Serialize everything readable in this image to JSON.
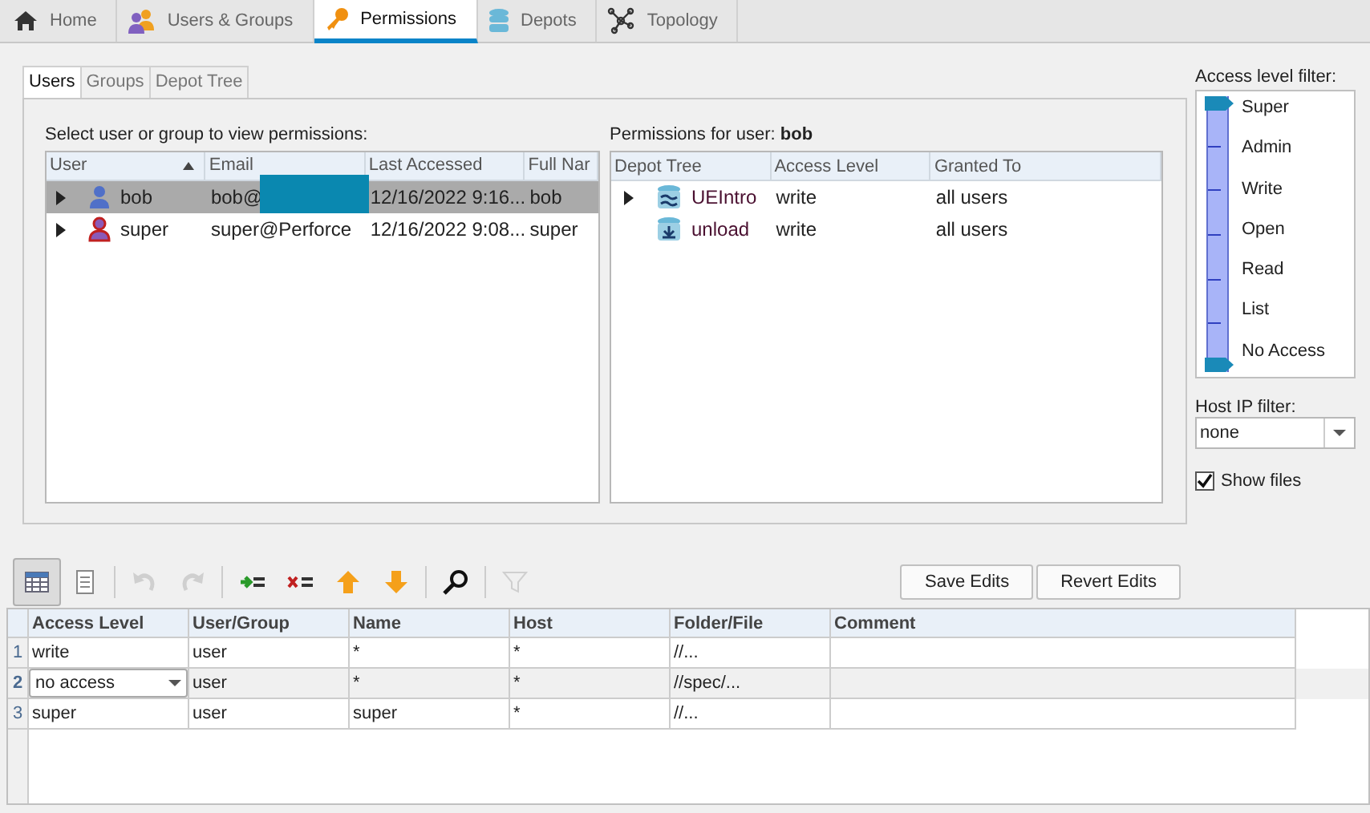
{
  "main_tabs": [
    {
      "label": "Home",
      "selected": false
    },
    {
      "label": "Users & Groups",
      "selected": false
    },
    {
      "label": "Permissions",
      "selected": true
    },
    {
      "label": "Depots",
      "selected": false
    },
    {
      "label": "Topology",
      "selected": false
    }
  ],
  "sub_tabs": [
    {
      "label": "Users",
      "selected": true
    },
    {
      "label": "Groups",
      "selected": false
    },
    {
      "label": "Depot Tree",
      "selected": false
    }
  ],
  "users_panel": {
    "prompt": "Select user or group to view permissions:",
    "columns": [
      {
        "label": "User",
        "sorted": true
      },
      {
        "label": "Email",
        "sorted": false
      },
      {
        "label": "Last Accessed",
        "sorted": false
      },
      {
        "label": "Full Nar",
        "sorted": false
      }
    ],
    "rows": [
      {
        "kind": "user",
        "user": "bob",
        "email": "bob@",
        "redacted": true,
        "last_accessed": "12/16/2022 9:16...",
        "full_name": "bob",
        "selected": true
      },
      {
        "kind": "super",
        "user": "super",
        "email": "super@Perforce",
        "redacted": false,
        "last_accessed": "12/16/2022 9:08...",
        "full_name": "super",
        "selected": false
      }
    ]
  },
  "permissions_panel": {
    "prompt": "Permissions for user: ",
    "user": "bob",
    "columns": [
      "Depot Tree",
      "Access Level",
      "Granted To"
    ],
    "rows": [
      {
        "kind": "stream",
        "expandable": true,
        "depot": "UEIntro",
        "access": "write",
        "granted_to": "all users"
      },
      {
        "kind": "unload",
        "expandable": false,
        "depot": "unload",
        "access": "write",
        "granted_to": "all users"
      }
    ]
  },
  "access_filter": {
    "title": "Access level filter:",
    "levels": [
      "Super",
      "Admin",
      "Write",
      "Open",
      "Read",
      "List",
      "No Access"
    ],
    "upper_thumb": {
      "level": 1
    },
    "lower_thumb": {
      "level": 0
    }
  },
  "host_filter": {
    "label": "Host IP filter:",
    "value": "none"
  },
  "show_files": {
    "label": "Show files",
    "checked": true
  },
  "toolbar": {
    "buttons": [
      {
        "kind": "grid",
        "selected": true,
        "disabled": false
      },
      {
        "kind": "list",
        "selected": false,
        "disabled": false
      },
      {
        "kind": "undo",
        "selected": false,
        "disabled": true
      },
      {
        "kind": "redo",
        "selected": false,
        "disabled": true
      },
      {
        "kind": "add",
        "selected": false,
        "disabled": false
      },
      {
        "kind": "delete",
        "selected": false,
        "disabled": false
      },
      {
        "kind": "up",
        "selected": false,
        "disabled": false
      },
      {
        "kind": "down",
        "selected": false,
        "disabled": false
      },
      {
        "kind": "search",
        "selected": false,
        "disabled": false
      },
      {
        "kind": "filter",
        "selected": false,
        "disabled": true
      }
    ],
    "actions": [
      "Save Edits",
      "Revert Edits"
    ]
  },
  "edit_table": {
    "columns": [
      "Access Level",
      "User/Group",
      "Name",
      "Host",
      "Folder/File",
      "Comment"
    ],
    "rows": [
      {
        "number": "1",
        "selected": false,
        "editing": false,
        "cells": [
          "write",
          "user",
          "*",
          "*",
          "//..."
        ]
      },
      {
        "number": "2",
        "selected": true,
        "editing": true,
        "cells": [
          "no access",
          "user",
          "*",
          "*",
          "//spec/..."
        ]
      },
      {
        "number": "3",
        "selected": false,
        "editing": false,
        "cells": [
          "super",
          "user",
          "super",
          "*",
          "//..."
        ]
      }
    ]
  }
}
